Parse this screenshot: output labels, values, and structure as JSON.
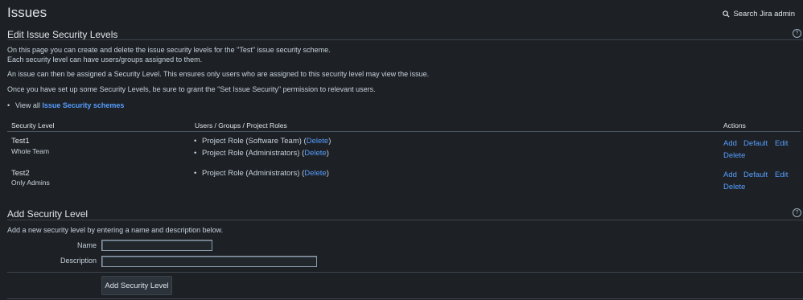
{
  "header": {
    "title": "Issues",
    "search_label": "Search Jira admin"
  },
  "edit_section": {
    "heading": "Edit Issue Security Levels",
    "help_icon": "?",
    "intro_line1": "On this page you can create and delete the issue security levels for the \"Test\" issue security scheme.",
    "intro_line2": "Each security level can have users/groups assigned to them.",
    "para2": "An issue can then be assigned a Security Level. This ensures only users who are assigned to this security level may view the issue.",
    "para3": "Once you have set up some Security Levels, be sure to grant the \"Set Issue Security\" permission to relevant users.",
    "view_all_prefix": "View all",
    "view_all_link": "Issue Security schemes"
  },
  "table": {
    "columns": [
      "Security Level",
      "Users / Groups / Project Roles",
      "Actions"
    ],
    "rows": [
      {
        "name": "Test1",
        "description": "Whole Team",
        "members": [
          {
            "text": "Project Role (Software Team)",
            "open": "(",
            "delete": "Delete",
            "close": ")"
          },
          {
            "text": "Project Role (Administrators)",
            "open": "(",
            "delete": "Delete",
            "close": ")"
          }
        ],
        "actions": [
          "Add",
          "Default",
          "Edit",
          "Delete"
        ]
      },
      {
        "name": "Test2",
        "description": "Only Admins",
        "members": [
          {
            "text": "Project Role (Administrators)",
            "open": "(",
            "delete": "Delete",
            "close": ")"
          }
        ],
        "actions": [
          "Add",
          "Default",
          "Edit",
          "Delete"
        ]
      }
    ]
  },
  "add_section": {
    "heading": "Add Security Level",
    "help_icon": "?",
    "description": "Add a new security level by entering a name and description below.",
    "name_label": "Name",
    "name_value": "",
    "description_label": "Description",
    "description_value": "",
    "submit_label": "Add Security Level"
  }
}
